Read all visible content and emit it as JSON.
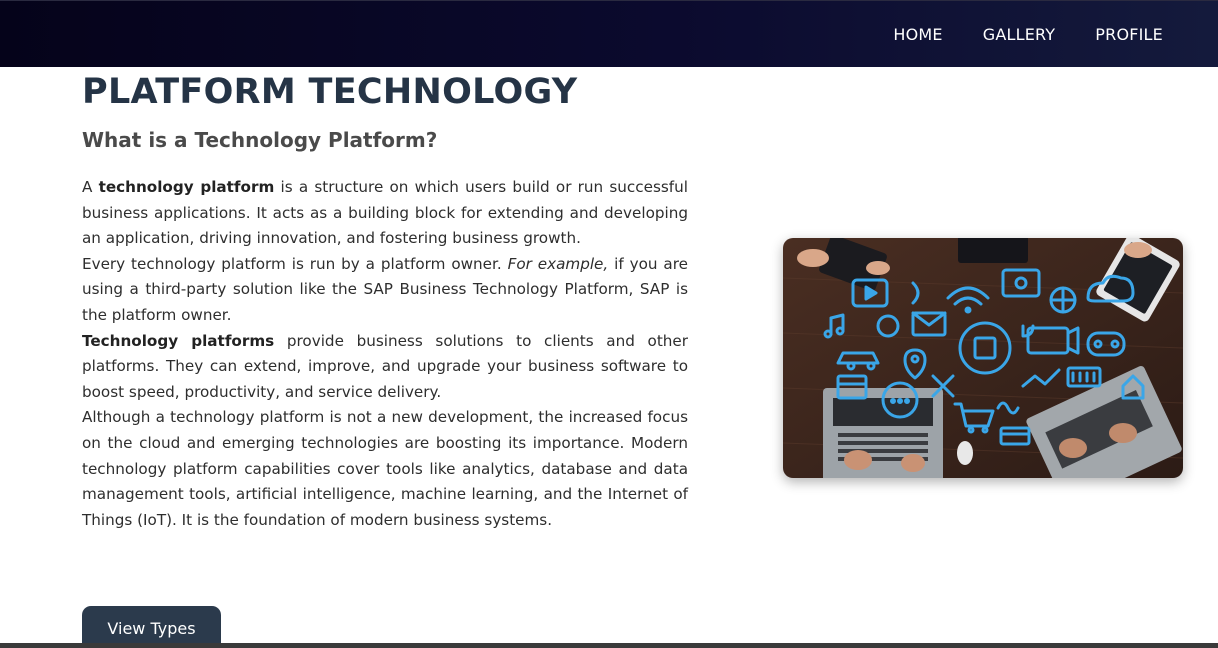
{
  "nav": {
    "items": [
      {
        "label": "HOME"
      },
      {
        "label": "GALLERY"
      },
      {
        "label": "PROFILE"
      }
    ]
  },
  "main": {
    "title": "PLATFORM TECHNOLOGY",
    "subtitle": "What is a Technology Platform?",
    "paragraphs": {
      "p1": {
        "lead": "A ",
        "strong": "technology platform",
        "rest": " is a structure on which users build or run successful business applications. It acts as a building block for extending and developing an application, driving innovation, and fostering business growth."
      },
      "p2": {
        "lead": "Every technology platform is run by a platform owner. ",
        "em": "For example,",
        "rest": " if you are using a third-party solution like the SAP Business Technology Platform, SAP is the platform owner."
      },
      "p3": {
        "strong": "Technology platforms",
        "rest": " provide business solutions to clients and other platforms. They can extend, improve, and upgrade your business software to boost speed, productivity, and service delivery."
      },
      "p4": {
        "text": "Although a technology platform is not a new development, the increased focus on the cloud and emerging technologies are boosting its importance. Modern technology platform capabilities cover tools like analytics, database and data management tools, artificial intelligence, machine learning, and the Internet of Things (IoT). It is the foundation of modern business systems."
      }
    },
    "cta_label": "View Types"
  },
  "colors": {
    "nav_bg": "#0b0a2e",
    "title": "#253446",
    "button_bg": "#2b3a4c",
    "icon_blue": "#3aa6e8"
  }
}
